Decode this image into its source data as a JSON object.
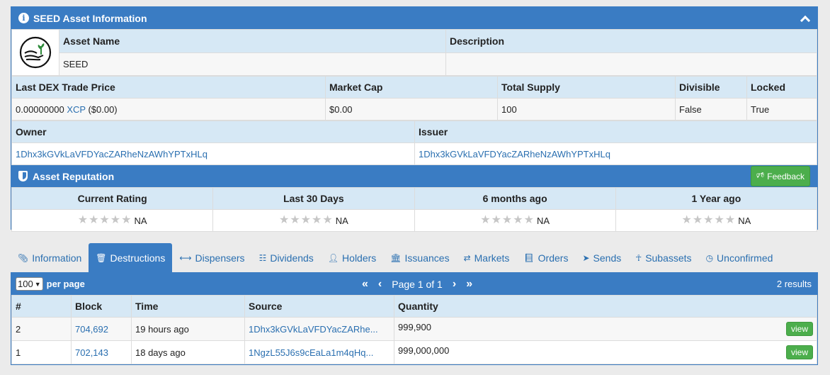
{
  "asset_panel": {
    "title": "SEED Asset Information",
    "name_label": "Asset Name",
    "name_value": "SEED",
    "desc_label": "Description",
    "desc_value": "",
    "price_label": "Last DEX Trade Price",
    "price_value": "0.00000000",
    "price_unit": "XCP",
    "price_usd": "($0.00)",
    "mcap_label": "Market Cap",
    "mcap_value": "$0.00",
    "supply_label": "Total Supply",
    "supply_value": "100",
    "divisible_label": "Divisible",
    "divisible_value": "False",
    "locked_label": "Locked",
    "locked_value": "True",
    "owner_label": "Owner",
    "owner_value": "1Dhx3kGVkLaVFDYacZARheNzAWhYPTxHLq",
    "issuer_label": "Issuer",
    "issuer_value": "1Dhx3kGVkLaVFDYacZARheNzAWhYPTxHLq"
  },
  "reputation": {
    "title": "Asset Reputation",
    "feedback_label": "Feedback",
    "columns": [
      {
        "label": "Current Rating",
        "value": "NA"
      },
      {
        "label": "Last 30 Days",
        "value": "NA"
      },
      {
        "label": "6 months ago",
        "value": "NA"
      },
      {
        "label": "1 Year ago",
        "value": "NA"
      }
    ]
  },
  "tabs": [
    {
      "label": "Information",
      "icon": "paperclip-icon",
      "active": false
    },
    {
      "label": "Destructions",
      "icon": "trash-icon",
      "active": true
    },
    {
      "label": "Dispensers",
      "icon": "arrows-h-icon",
      "active": false
    },
    {
      "label": "Dividends",
      "icon": "sitemap-icon",
      "active": false
    },
    {
      "label": "Holders",
      "icon": "user-icon",
      "active": false
    },
    {
      "label": "Issuances",
      "icon": "bank-icon",
      "active": false
    },
    {
      "label": "Markets",
      "icon": "exchange-icon",
      "active": false
    },
    {
      "label": "Orders",
      "icon": "book-icon",
      "active": false
    },
    {
      "label": "Sends",
      "icon": "send-icon",
      "active": false
    },
    {
      "label": "Subassets",
      "icon": "child-icon",
      "active": false
    },
    {
      "label": "Unconfirmed",
      "icon": "clock-icon",
      "active": false
    }
  ],
  "list": {
    "per_page_value": "100",
    "per_page_label": "per page",
    "page_label": "Page 1 of 1",
    "results": "2 results",
    "headers": {
      "num": "#",
      "block": "Block",
      "time": "Time",
      "source": "Source",
      "quantity": "Quantity"
    },
    "view_label": "view",
    "rows": [
      {
        "num": "2",
        "block": "704,692",
        "time": "19 hours ago",
        "source": "1Dhx3kGVkLaVFDYacZARhe...",
        "quantity": "999,900"
      },
      {
        "num": "1",
        "block": "702,143",
        "time": "18 days ago",
        "source": "1NgzL55J6s9cEaLa1m4qHq...",
        "quantity": "999,000,000"
      }
    ]
  }
}
